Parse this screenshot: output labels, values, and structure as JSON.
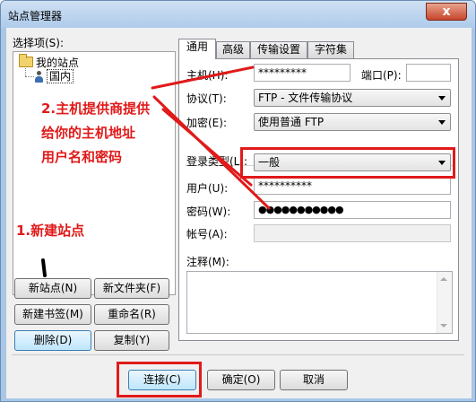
{
  "window": {
    "title": "站点管理器",
    "close_symbol": "x"
  },
  "left": {
    "label": "选择项(S):",
    "tree_root": "我的站点",
    "tree_child": "国内",
    "buttons": {
      "new_site": "新站点(N)",
      "new_folder": "新文件夹(F)",
      "new_bookmark": "新建书签(M)",
      "rename": "重命名(R)",
      "delete": "删除(D)",
      "copy": "复制(Y)"
    }
  },
  "tabs": [
    {
      "label": "通用",
      "active": true
    },
    {
      "label": "高级",
      "active": false
    },
    {
      "label": "传输设置",
      "active": false
    },
    {
      "label": "字符集",
      "active": false
    }
  ],
  "form": {
    "host_label": "主机(H):",
    "host_value": "*********",
    "port_label": "端口(P):",
    "port_value": "",
    "protocol_label": "协议(T):",
    "protocol_value": "FTP - 文件传输协议",
    "encryption_label": "加密(E):",
    "encryption_value": "使用普通 FTP",
    "logon_label": "登录类型(L):",
    "logon_value": "一般",
    "user_label": "用户(U):",
    "user_value": "**********",
    "password_label": "密码(W):",
    "password_value": "●●●●●●●●●●●",
    "account_label": "帐号(A):",
    "account_value": "",
    "comment_label": "注释(M):",
    "comment_value": ""
  },
  "footer": {
    "connect": "连接(C)",
    "ok": "确定(O)",
    "cancel": "取消"
  },
  "annotations": {
    "step1": "1.新建站点",
    "step2_line1": "2.主机提供商提供",
    "step2_line2": "给你的主机地址",
    "step2_line3": "用户名和密码",
    "color": "#e01a1a"
  }
}
